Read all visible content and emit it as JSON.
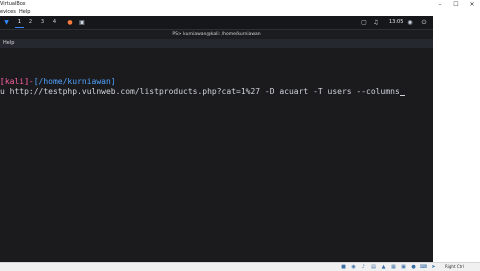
{
  "vbox": {
    "title": "VirtualBox",
    "menu": [
      "evices",
      "Help"
    ],
    "minimize": "–",
    "maximize": "☐",
    "close": "✕"
  },
  "panel": {
    "workspaces": [
      "1",
      "2",
      "3",
      "4"
    ],
    "clock": "13:05"
  },
  "terminal": {
    "title": "PS> kurniawan@kali: /home/kurniawan",
    "menu_help": "Help",
    "prompt_prefix": "⟦kali⟧-",
    "prompt_path": "[/home/kurniawan]",
    "command": "u http://testphp.vulnweb.com/listproducts.php?cat=1%27 -D acuart -T users --columns"
  },
  "status": {
    "host_key": "Right Ctrl"
  },
  "icons": {
    "kali": "dragon-icon",
    "terminal": "terminal-icon"
  }
}
